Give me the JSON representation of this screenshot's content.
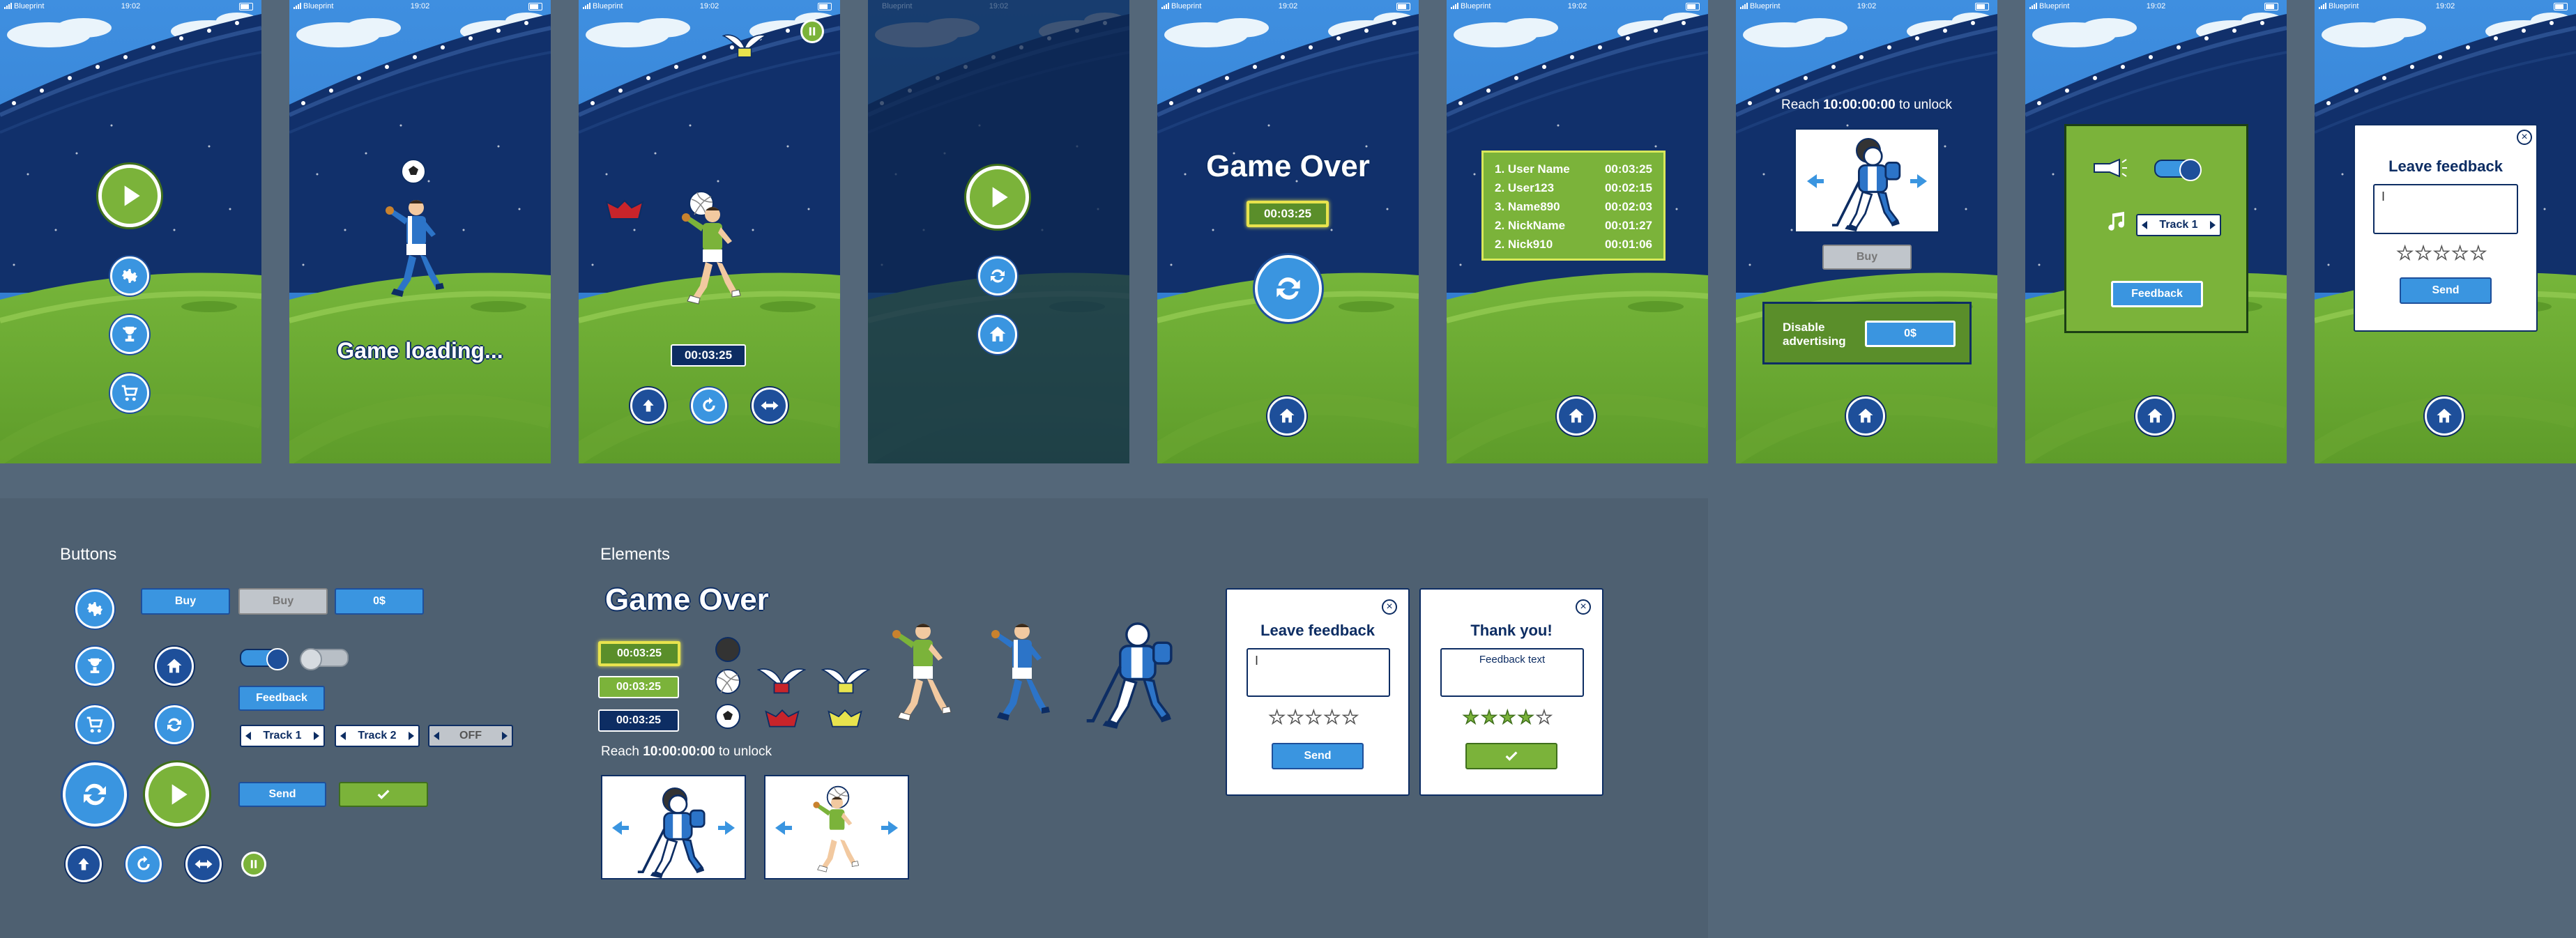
{
  "status_bar": {
    "carrier": "Blueprint",
    "time": "19:02"
  },
  "screens": {
    "menu": {},
    "loading": {
      "text": "Game loading..."
    },
    "gameplay": {
      "timer": "00:03:25"
    },
    "pause": {},
    "game_over": {
      "title": "Game Over",
      "timer": "00:03:25"
    },
    "leaderboard": {
      "rows": [
        {
          "name": "1. User Name",
          "time": "00:03:25"
        },
        {
          "name": "2. User123",
          "time": "00:02:15"
        },
        {
          "name": "3. Name890",
          "time": "00:02:03"
        },
        {
          "name": "2. NickName",
          "time": "00:01:27"
        },
        {
          "name": "2. Nick910",
          "time": "00:01:06"
        }
      ]
    },
    "shop": {
      "reach_prefix": "Reach",
      "reach_value": "10:00:00:00",
      "reach_suffix": "to unlock",
      "buy_label": "Buy",
      "ads_label": "Disable advertising",
      "ads_price": "0$"
    },
    "settings": {
      "track_label": "Track 1",
      "feedback_label": "Feedback"
    },
    "feedback": {
      "title": "Leave feedback",
      "input_value": "I",
      "send_label": "Send"
    }
  },
  "kit": {
    "buttons_title": "Buttons",
    "elements_title": "Elements",
    "buy_labels": [
      "Buy",
      "Buy",
      "0$"
    ],
    "feedback_label": "Feedback",
    "tracks": [
      "Track 1",
      "Track 2",
      "OFF"
    ],
    "send_label": "Send",
    "game_over": "Game Over",
    "timers": [
      "00:03:25",
      "00:03:25",
      "00:03:25"
    ],
    "reach_prefix": "Reach",
    "reach_value": "10:00:00:00",
    "reach_suffix": "to unlock",
    "feedback_card": {
      "title": "Leave feedback",
      "input_value": "I",
      "send_label": "Send"
    },
    "thanks_card": {
      "title": "Thank you!",
      "text": "Feedback text",
      "rating": 4
    }
  },
  "colors": {
    "accent_blue": "#3a95e0",
    "navy": "#1e4f9a",
    "green": "#7bb33a",
    "highlight_yellow": "#e8e34d"
  }
}
